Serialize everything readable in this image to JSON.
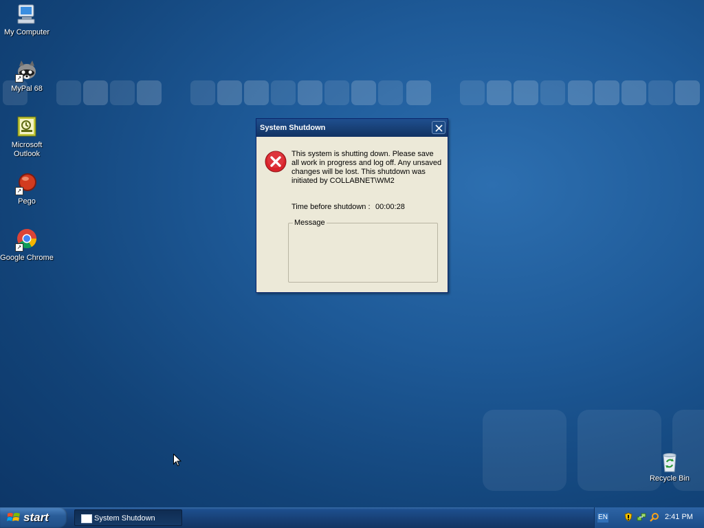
{
  "desktop": {
    "icons": [
      {
        "label": "My Computer",
        "icon": "my-computer-icon"
      },
      {
        "label": "MyPal 68",
        "icon": "mypal-raccoon-icon"
      },
      {
        "label": "Microsoft\nOutlook",
        "icon": "outlook-icon"
      },
      {
        "label": "Pego",
        "icon": "pego-icon"
      },
      {
        "label": "Google Chrome",
        "icon": "chrome-icon"
      }
    ],
    "recycle_bin": {
      "label": "Recycle Bin",
      "icon": "recycle-bin-icon"
    }
  },
  "dialog": {
    "title": "System Shutdown",
    "message": "This system is shutting down. Please save all work in progress and log off. Any unsaved changes will be lost. This shutdown was initiated by COLLABNET\\WM2",
    "timer_label": "Time before shutdown :",
    "timer_value": "00:00:28",
    "group_label": "Message",
    "message_box_value": ""
  },
  "taskbar": {
    "start_label": "start",
    "items": [
      {
        "label": "System Shutdown"
      }
    ],
    "tray": {
      "language": "EN",
      "icons": [
        "security-shield-icon",
        "network-icon",
        "search-icon"
      ],
      "clock": "2:41 PM"
    }
  },
  "colors": {
    "desktop_blue": "#1e5a98",
    "title_bar": "#173e73",
    "dialog_face": "#ece9d8",
    "error_red": "#d8232a"
  }
}
